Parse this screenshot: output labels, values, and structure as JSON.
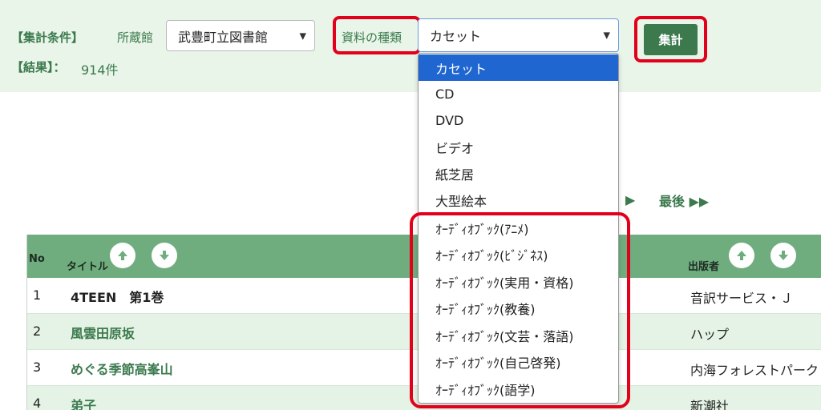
{
  "filter": {
    "conditions_label": "【集計条件】",
    "holding_label": "所蔵館",
    "holding_value": "武豊町立図書館",
    "material_type_label": "資料の種類",
    "material_type_value": "カセット",
    "submit_label": "集計",
    "result_label": "【結果】：",
    "result_count": "914件"
  },
  "pager": {
    "next_symbol": "▶",
    "last_label": "最後 ▶▶"
  },
  "table": {
    "headers": {
      "no": "No",
      "title": "タイトル",
      "publisher": "出版者"
    },
    "rows": [
      {
        "no": "1",
        "title": "4TEEN　第1巻",
        "publisher": "音訳サービス・Ｊ"
      },
      {
        "no": "2",
        "title": "風雲田原坂",
        "publisher": "ハップ"
      },
      {
        "no": "3",
        "title": "めぐる季節高峯山",
        "publisher": "内海フォレストパーク"
      },
      {
        "no": "4",
        "title": "弟子",
        "publisher": "新潮社"
      }
    ]
  },
  "dropdown": {
    "options": [
      "カセット",
      "CD",
      "DVD",
      "ビデオ",
      "紙芝居",
      "大型絵本",
      "ｵｰﾃﾞｨｵﾌﾞｯｸ(ｱﾆﾒ)",
      "ｵｰﾃﾞｨｵﾌﾞｯｸ(ﾋﾞｼﾞﾈｽ)",
      "ｵｰﾃﾞｨｵﾌﾞｯｸ(実用・資格)",
      "ｵｰﾃﾞｨｵﾌﾞｯｸ(教養)",
      "ｵｰﾃﾞｨｵﾌﾞｯｸ(文芸・落語)",
      "ｵｰﾃﾞｨｵﾌﾞｯｸ(自己啓発)",
      "ｵｰﾃﾞｨｵﾌﾞｯｸ(語学)"
    ]
  },
  "colors": {
    "accent_green": "#3c7a4e",
    "panel_bg": "#e9f5e9",
    "table_header_bg": "#6fad7e",
    "highlight_red": "#e3001b",
    "selected_option_bg": "#1f66d1"
  }
}
